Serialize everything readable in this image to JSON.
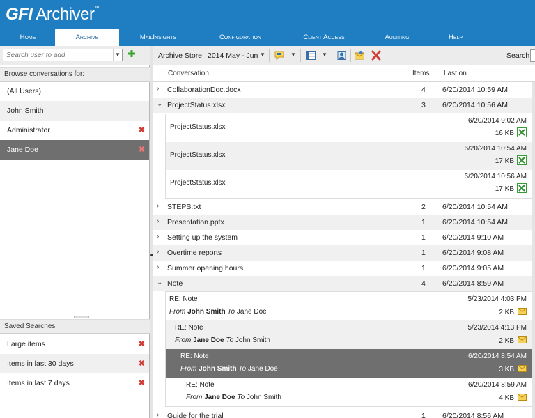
{
  "app": {
    "logo_bold": "GFI",
    "logo_rest": " Archiver",
    "logo_tm": "™"
  },
  "nav": {
    "tabs": [
      {
        "label": "Home"
      },
      {
        "label": "Archive"
      },
      {
        "label": "MailInsights"
      },
      {
        "label": "Configuration"
      },
      {
        "label": "Client Access"
      },
      {
        "label": "Auditing"
      },
      {
        "label": "Help"
      }
    ],
    "active": "Archive"
  },
  "left": {
    "search_placeholder": "Search user to add",
    "browse_header": "Browse conversations for:",
    "users": [
      {
        "name": "(All Users)",
        "removable": false
      },
      {
        "name": "John Smith",
        "removable": false
      },
      {
        "name": "Administrator",
        "removable": true
      },
      {
        "name": "Jane Doe",
        "removable": true
      }
    ],
    "selected_user": "Jane Doe",
    "saved_header": "Saved Searches",
    "saved": [
      {
        "name": "Large items"
      },
      {
        "name": "Items in last 30 days"
      },
      {
        "name": "Items in last 7 days"
      }
    ]
  },
  "toolbar": {
    "store_label": "Archive Store:",
    "store_value": "2014 May - Jun",
    "search_label": "Search:"
  },
  "columns": {
    "conversation": "Conversation",
    "items": "Items",
    "last_on": "Last on"
  },
  "conversations": [
    {
      "name": "CollaborationDoc.docx",
      "items": "4",
      "last_on": "6/20/2014 10:59 AM",
      "expanded": false
    },
    {
      "name": "ProjectStatus.xlsx",
      "items": "3",
      "last_on": "6/20/2014 10:56 AM",
      "expanded": true
    },
    {
      "name": "STEPS.txt",
      "items": "2",
      "last_on": "6/20/2014 10:54 AM",
      "expanded": false
    },
    {
      "name": "Presentation.pptx",
      "items": "1",
      "last_on": "6/20/2014 10:54 AM",
      "expanded": false
    },
    {
      "name": "Setting up the system",
      "items": "1",
      "last_on": "6/20/2014 9:10 AM",
      "expanded": false
    },
    {
      "name": "Overtime reports",
      "items": "1",
      "last_on": "6/20/2014 9:08 AM",
      "expanded": false
    },
    {
      "name": "Summer opening hours",
      "items": "1",
      "last_on": "6/20/2014 9:05 AM",
      "expanded": false
    },
    {
      "name": "Note",
      "items": "4",
      "last_on": "6/20/2014 8:59 AM",
      "expanded": true
    },
    {
      "name": "Guide for the trial",
      "items": "1",
      "last_on": "6/20/2014 8:56 AM",
      "expanded": false
    }
  ],
  "files": [
    {
      "name": "ProjectStatus.xlsx",
      "date": "6/20/2014 9:02 AM",
      "size": "16 KB"
    },
    {
      "name": "ProjectStatus.xlsx",
      "date": "6/20/2014 10:54 AM",
      "size": "17 KB"
    },
    {
      "name": "ProjectStatus.xlsx",
      "date": "6/20/2014 10:56 AM",
      "size": "17 KB"
    }
  ],
  "mails": [
    {
      "subject": "RE: Note",
      "from_label": "From",
      "from": "John Smith",
      "to_label": "To",
      "to": "Jane Doe",
      "date": "5/23/2014 4:03 PM",
      "size": "2 KB"
    },
    {
      "subject": "RE: Note",
      "from_label": "From",
      "from": "Jane Doe",
      "to_label": "To",
      "to": "John Smith",
      "date": "5/23/2014 4:13 PM",
      "size": "2 KB"
    },
    {
      "subject": "RE: Note",
      "from_label": "From",
      "from": "John Smith",
      "to_label": "To",
      "to": "Jane Doe",
      "date": "6/20/2014 8:54 AM",
      "size": "3 KB"
    },
    {
      "subject": "RE: Note",
      "from_label": "From",
      "from": "Jane Doe",
      "to_label": "To",
      "to": "John Smith",
      "date": "6/20/2014 8:59 AM",
      "size": "4 KB"
    }
  ],
  "colors": {
    "brand_blue": "#1f7ec2",
    "selected_gray": "#6f6f6f",
    "remove_red": "#d23b33"
  }
}
